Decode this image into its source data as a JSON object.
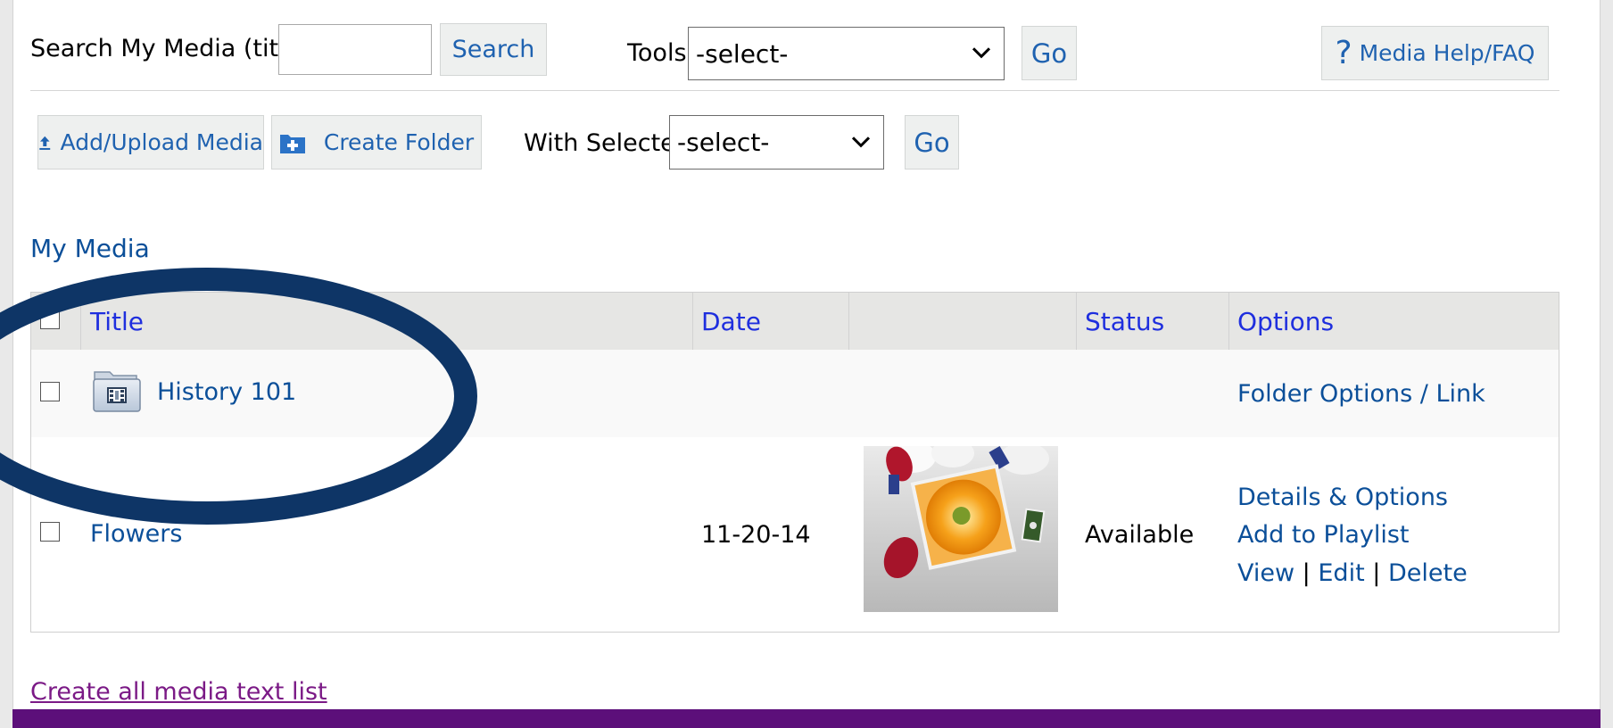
{
  "search": {
    "label": "Search My Media (title):",
    "value": "",
    "button": "Search"
  },
  "tools": {
    "label": "Tools",
    "selected": "-select-",
    "go": "Go"
  },
  "help": {
    "icon": "?",
    "label": "Media Help/FAQ"
  },
  "actions": {
    "add_upload": "Add/Upload Media",
    "create_folder": "Create Folder",
    "with_selected_label": "With Selected",
    "with_selected_value": "-select-",
    "go": "Go"
  },
  "section_title": "My Media",
  "table": {
    "headers": [
      "Title",
      "Date",
      "",
      "Status",
      "Options"
    ],
    "rows": [
      {
        "type": "folder",
        "title": "History 101",
        "date": "",
        "status": "",
        "options": [
          "Folder Options / Link"
        ]
      },
      {
        "type": "media",
        "title": "Flowers",
        "date": "11-20-14",
        "status": "Available",
        "options": [
          "Details & Options",
          "Add to Playlist"
        ],
        "inline_options": [
          "View",
          "Edit",
          "Delete"
        ],
        "separator": "|"
      }
    ]
  },
  "footer_link": "Create all media text list",
  "colors": {
    "link": "#0b4f99",
    "header_link": "#1f2fde",
    "footer_bar": "#5c0f7a",
    "annotation_ellipse": "#0e3566"
  },
  "icons": {
    "upload": "upload-arrow-icon",
    "folder_add": "add-folder-icon",
    "folder": "media-folder-icon",
    "chevron": "chevron-down-icon"
  }
}
